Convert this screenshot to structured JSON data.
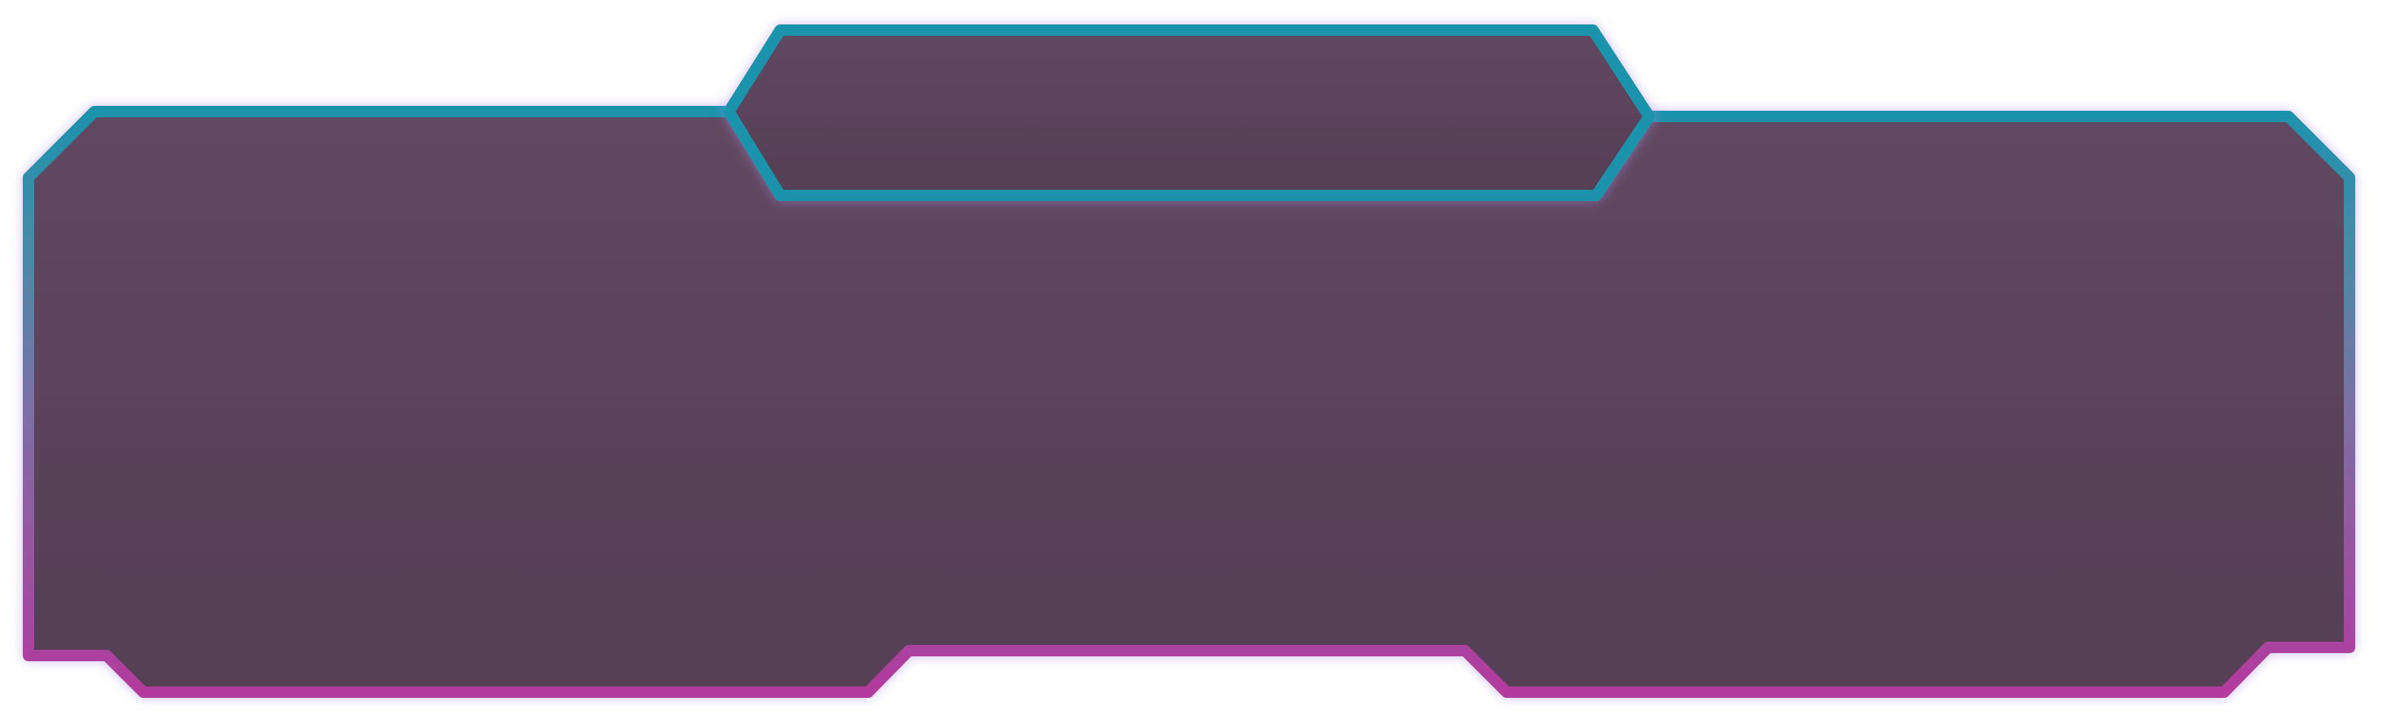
{
  "frame": {
    "panel_fill_top": "#604860",
    "panel_fill_bottom": "#553f55",
    "border_top_color": "#1b93ad",
    "border_bottom_color": "#b33a9e",
    "glow_color": "#a98be8"
  }
}
